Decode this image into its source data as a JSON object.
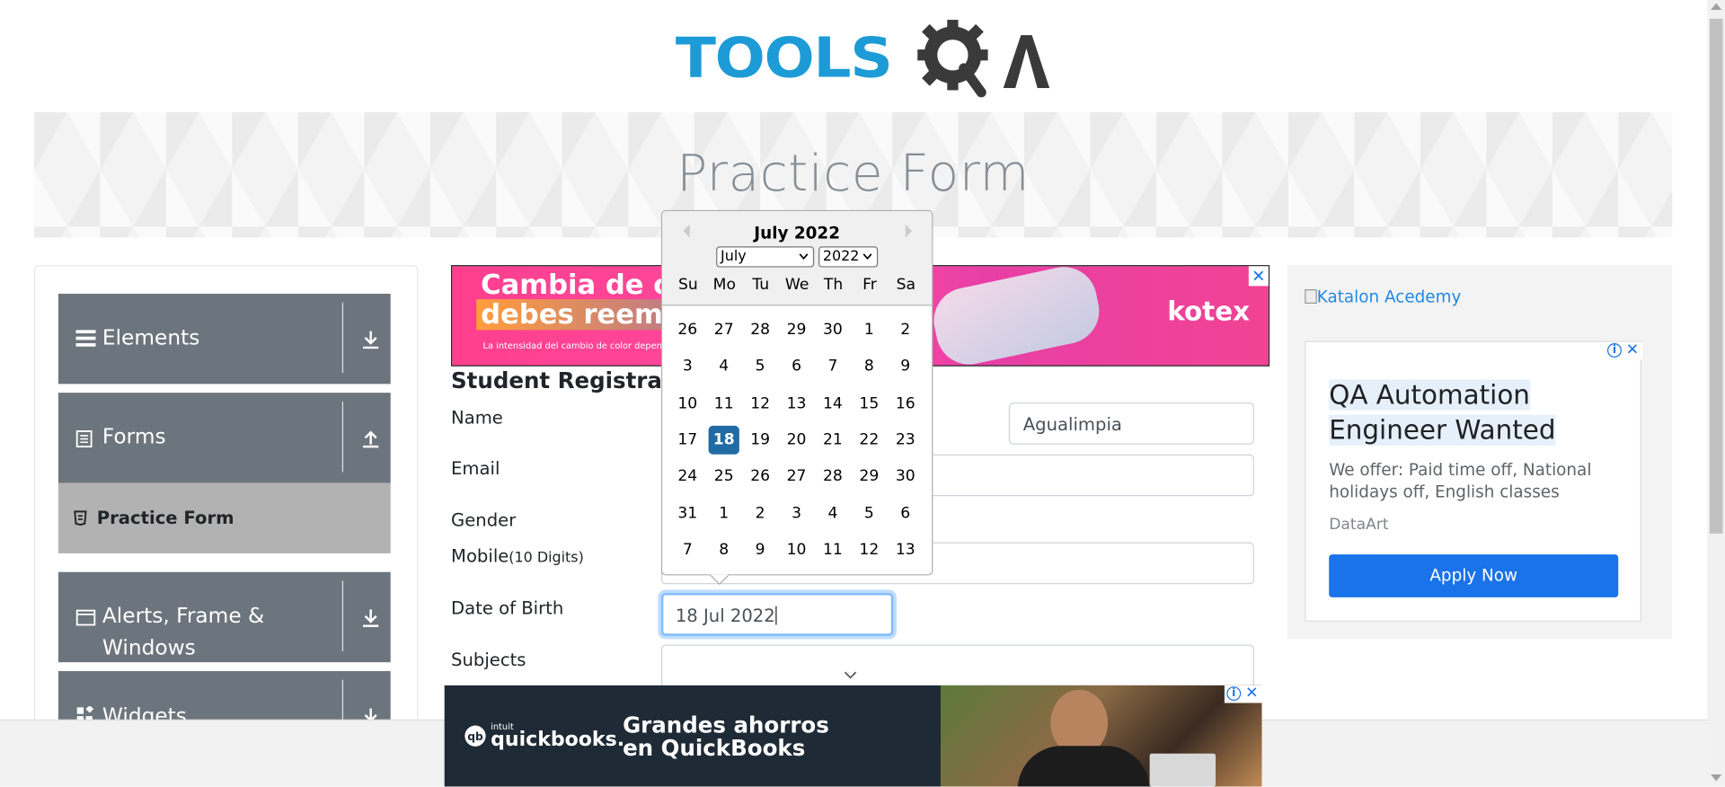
{
  "logo": {
    "text": "TOOLS",
    "qa": "QA"
  },
  "page": {
    "title": "Practice Form"
  },
  "sidebar": {
    "groups": [
      {
        "label": "Elements",
        "icon": "menu-icon",
        "arrow": "download-icon"
      },
      {
        "label": "Forms",
        "icon": "document-icon",
        "arrow": "upload-icon"
      },
      {
        "label": "Alerts, Frame &",
        "label2": "Windows",
        "icon": "window-icon",
        "arrow": "download-icon"
      },
      {
        "label": "Widgets",
        "icon": "widgets-icon",
        "arrow": "download-icon"
      }
    ],
    "active_item": "Practice Form"
  },
  "ads": {
    "top": {
      "line1": "Cambia de c",
      "line2": "debes reemp",
      "small": "La intensidad del cambio de color dependerá",
      "brand": "kotex"
    },
    "katalon_alt": "Katalon Acedemy",
    "job": {
      "headline1": "QA Automation",
      "headline2": "Engineer Wanted",
      "body": "We offer: Paid time off, National holidays off, English classes",
      "advertiser": "DataArt",
      "cta": "Apply Now"
    },
    "bottom": {
      "brand_small": "intuit",
      "brand": "quickbooks.",
      "line1": "Grandes ahorros",
      "line2": "en QuickBooks"
    }
  },
  "form": {
    "title": "Student Registration",
    "labels": {
      "name": "Name",
      "email": "Email",
      "gender": "Gender",
      "mobile": "Mobile",
      "mobile_hint": "(10 Digits)",
      "dob": "Date of Birth",
      "subjects": "Subjects"
    },
    "last_name_value": "Agualimpia",
    "dob_value": "18 Jul 2022"
  },
  "calendar": {
    "title": "July 2022",
    "month_select": "July",
    "year_select": "2022",
    "weekdays": [
      "Su",
      "Mo",
      "Tu",
      "We",
      "Th",
      "Fr",
      "Sa"
    ],
    "weeks": [
      [
        "26",
        "27",
        "28",
        "29",
        "30",
        "1",
        "2"
      ],
      [
        "3",
        "4",
        "5",
        "6",
        "7",
        "8",
        "9"
      ],
      [
        "10",
        "11",
        "12",
        "13",
        "14",
        "15",
        "16"
      ],
      [
        "17",
        "18",
        "19",
        "20",
        "21",
        "22",
        "23"
      ],
      [
        "24",
        "25",
        "26",
        "27",
        "28",
        "29",
        "30"
      ],
      [
        "31",
        "1",
        "2",
        "3",
        "4",
        "5",
        "6"
      ],
      [
        "7",
        "8",
        "9",
        "10",
        "11",
        "12",
        "13"
      ]
    ],
    "selected": "18"
  },
  "colors": {
    "accent": "#216ba5",
    "sidebar_group": "#6c757d",
    "ad_button": "#1a73e8",
    "logo_blue": "#1d9bd6"
  }
}
